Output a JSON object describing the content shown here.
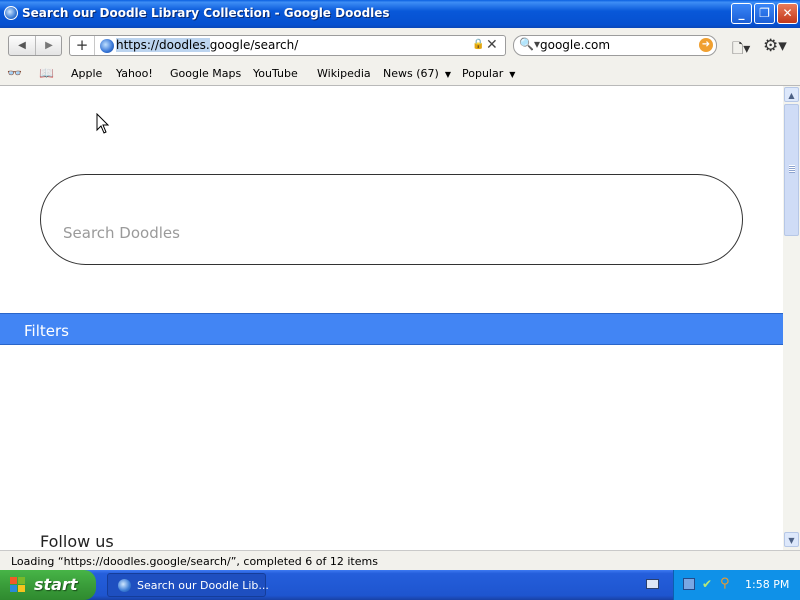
{
  "window": {
    "title": "Search our Doodle Library Collection - Google Doodles",
    "controls": {
      "minimize": "_",
      "maximize": "❐",
      "close": "✕"
    }
  },
  "toolbar": {
    "back_icon": "◀",
    "forward_icon": "▶",
    "new_tab_icon": "+",
    "url_highlight": "https://doodles.",
    "url_rest": "google/search/",
    "lock_icon": "🔒",
    "clear_icon": "✕",
    "search_icon": "🔍",
    "search_dropdown": "▾",
    "search_text": "google.com",
    "search_go_icon": "➜",
    "page_menu_icon": "🗋▾",
    "settings_icon": "⚙▾"
  },
  "bookmarks": {
    "reading_list_icon": "👓",
    "bookmarks_icon": "📖",
    "items": [
      {
        "label": "Apple"
      },
      {
        "label": "Yahoo!"
      },
      {
        "label": "Google Maps"
      },
      {
        "label": "YouTube"
      },
      {
        "label": "Wikipedia"
      },
      {
        "label": "News (67)",
        "dropdown": "▼"
      },
      {
        "label": "Popular",
        "dropdown": "▼"
      }
    ]
  },
  "page": {
    "search_placeholder": "Search Doodles",
    "filters_label": "Filters",
    "follow_heading": "Follow us"
  },
  "scrollbar": {
    "up": "▲",
    "down": "▼"
  },
  "status_text": "Loading “https://doodles.google/search/”, completed 6 of 12 items",
  "taskbar": {
    "start_label": "start",
    "task_label": "Search our Doodle Lib...",
    "clock": "1:58 PM"
  },
  "colors": {
    "filters_bar": "#4285f4",
    "title_bar": "#0858d9",
    "start_button": "#3a9d3a"
  }
}
